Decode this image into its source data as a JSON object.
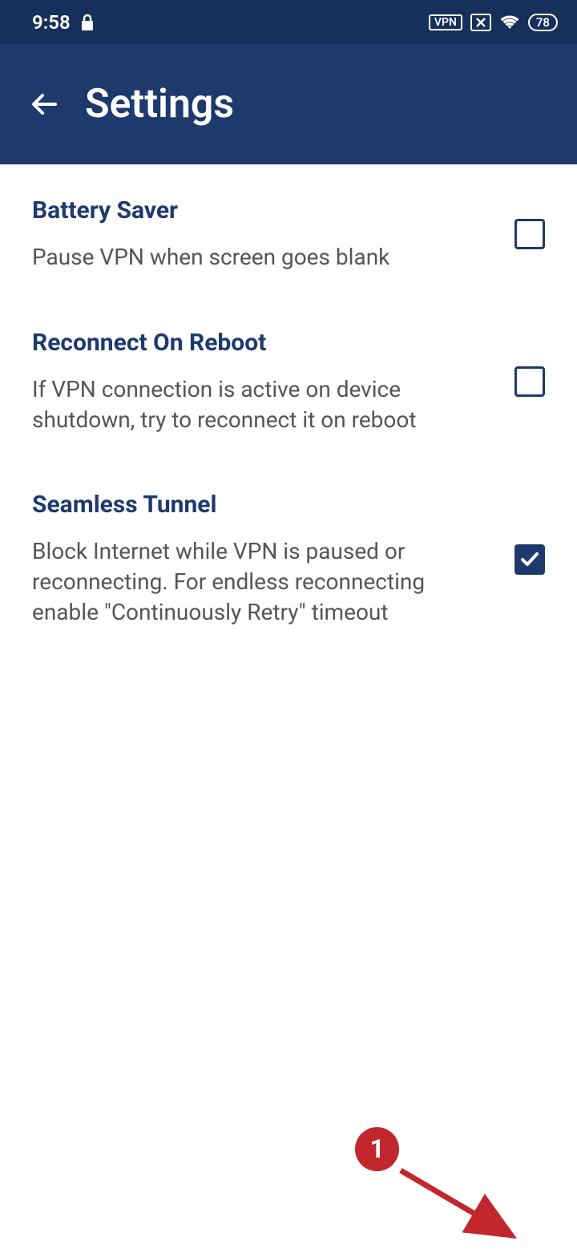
{
  "statusBar": {
    "time": "9:58",
    "vpnLabel": "VPN",
    "batteryLevel": "78"
  },
  "appBar": {
    "title": "Settings"
  },
  "settings": [
    {
      "title": "Battery Saver",
      "description": "Pause VPN when screen goes blank",
      "checked": false
    },
    {
      "title": "Reconnect On Reboot",
      "description": "If VPN connection is active on device shutdown, try to reconnect it on reboot",
      "checked": false
    },
    {
      "title": "Seamless Tunnel",
      "description": "Block Internet while VPN is paused or reconnecting. For endless reconnecting enable \"Continuously Retry\" timeout",
      "checked": true
    }
  ],
  "annotation": {
    "number": "1",
    "color": "#c1272d"
  }
}
